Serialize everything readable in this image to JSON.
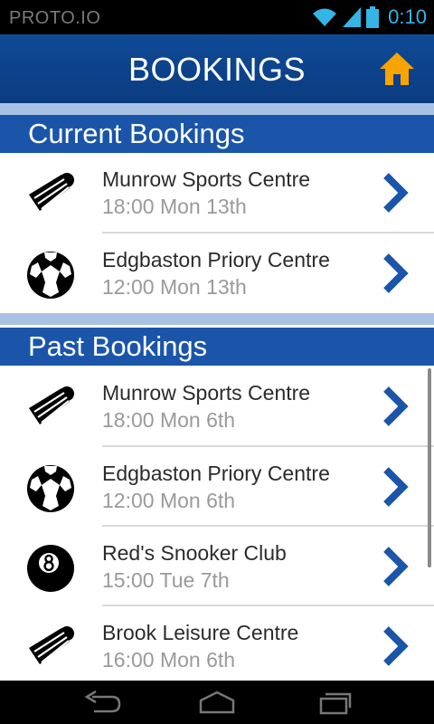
{
  "status_bar": {
    "carrier": "PROTO.IO",
    "time": "0:10"
  },
  "header": {
    "title": "BOOKINGS",
    "home_icon": "home-icon",
    "accent": "#f7a400"
  },
  "sections": {
    "current": {
      "title": "Current Bookings",
      "items": [
        {
          "icon": "badminton-shuttlecock-icon",
          "name": "Munrow Sports Centre",
          "time": "18:00 Mon 13th"
        },
        {
          "icon": "soccer-ball-icon",
          "name": "Edgbaston Priory Centre",
          "time": "12:00 Mon 13th"
        }
      ]
    },
    "past": {
      "title": "Past Bookings",
      "items": [
        {
          "icon": "badminton-shuttlecock-icon",
          "name": "Munrow Sports Centre",
          "time": "18:00 Mon 6th"
        },
        {
          "icon": "soccer-ball-icon",
          "name": "Edgbaston Priory Centre",
          "time": "12:00 Mon 6th"
        },
        {
          "icon": "eight-ball-icon",
          "name": "Red's Snooker Club",
          "time": "15:00 Tue 7th"
        },
        {
          "icon": "badminton-shuttlecock-icon",
          "name": "Brook Leisure Centre",
          "time": "16:00 Mon 6th"
        }
      ]
    }
  },
  "colors": {
    "header_bg": "#0d4490",
    "section_bg": "#1a55aa",
    "section_gap": "#a9c2e4",
    "chevron": "#1a55aa",
    "time_text": "#9a9a9a"
  },
  "nav_bar": {
    "icons": [
      "back-icon",
      "home-nav-icon",
      "recent-apps-icon"
    ]
  }
}
